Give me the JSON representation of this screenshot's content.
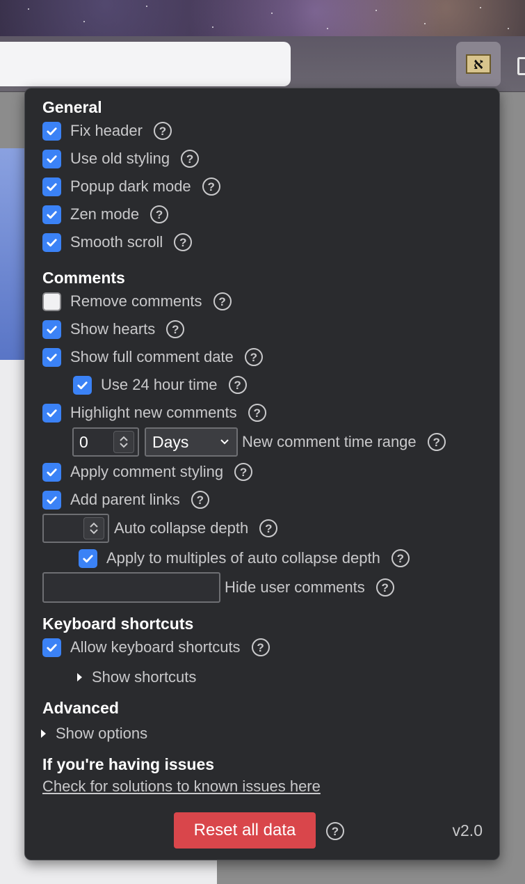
{
  "extension": {
    "icon_glyph": "א",
    "icon_name": "aleph-extension-icon"
  },
  "general": {
    "title": "General",
    "items": [
      {
        "label": "Fix header",
        "checked": true
      },
      {
        "label": "Use old styling",
        "checked": true
      },
      {
        "label": "Popup dark mode",
        "checked": true
      },
      {
        "label": "Zen mode",
        "checked": true
      },
      {
        "label": "Smooth scroll",
        "checked": true
      }
    ]
  },
  "comments": {
    "title": "Comments",
    "remove_comments": {
      "label": "Remove comments",
      "checked": false
    },
    "show_hearts": {
      "label": "Show hearts",
      "checked": true
    },
    "show_full_date": {
      "label": "Show full comment date",
      "checked": true
    },
    "use_24_hour": {
      "label": "Use 24 hour time",
      "checked": true
    },
    "highlight_new": {
      "label": "Highlight new comments",
      "checked": true
    },
    "time_range": {
      "value": "0",
      "unit": "Days",
      "label": "New comment time range"
    },
    "apply_styling": {
      "label": "Apply comment styling",
      "checked": true
    },
    "parent_links": {
      "label": "Add parent links",
      "checked": true
    },
    "auto_collapse": {
      "value": "",
      "label": "Auto collapse depth"
    },
    "apply_multiples": {
      "label": "Apply to multiples of auto collapse depth",
      "checked": true
    },
    "hide_user": {
      "value": "",
      "label": "Hide user comments"
    }
  },
  "keyboard": {
    "title": "Keyboard shortcuts",
    "allow": {
      "label": "Allow keyboard shortcuts",
      "checked": true
    },
    "show_shortcuts": "Show shortcuts"
  },
  "advanced": {
    "title": "Advanced",
    "show_options": "Show options"
  },
  "issues": {
    "title": "If you're having issues",
    "link": "Check for solutions to known issues here"
  },
  "footer": {
    "reset_label": "Reset all data",
    "version": "v2.0"
  },
  "help_glyph": "?",
  "colors": {
    "accent": "#3b82f6",
    "danger": "#d9464b",
    "popup_bg": "#2a2b2e"
  }
}
